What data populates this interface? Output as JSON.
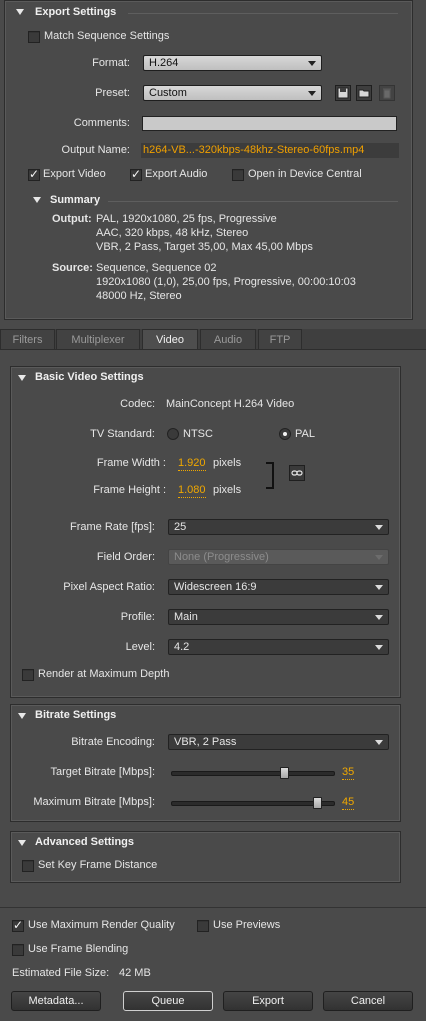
{
  "export_settings": {
    "title": "Export Settings",
    "match_sequence": {
      "label": "Match Sequence Settings",
      "checked": false
    },
    "format": {
      "label": "Format:",
      "value": "H.264"
    },
    "preset": {
      "label": "Preset:",
      "value": "Custom"
    },
    "comments": {
      "label": "Comments:",
      "value": ""
    },
    "output_name": {
      "label": "Output Name:",
      "value": "h264-VB...-320kbps-48khz-Stereo-60fps.mp4"
    },
    "export_video": {
      "label": "Export Video",
      "checked": true
    },
    "export_audio": {
      "label": "Export Audio",
      "checked": true
    },
    "open_device_central": {
      "label": "Open in Device Central",
      "checked": false
    }
  },
  "summary": {
    "title": "Summary",
    "output_label": "Output:",
    "output_lines": [
      "PAL, 1920x1080, 25 fps, Progressive",
      "AAC, 320 kbps, 48 kHz, Stereo",
      "VBR, 2 Pass, Target 35,00, Max 45,00 Mbps"
    ],
    "source_label": "Source:",
    "source_lines": [
      "Sequence, Sequence 02",
      "1920x1080 (1,0), 25,00 fps, Progressive, 00:00:10:03",
      "48000 Hz, Stereo"
    ]
  },
  "tabs": [
    {
      "label": "Filters",
      "active": false
    },
    {
      "label": "Multiplexer",
      "active": false
    },
    {
      "label": "Video",
      "active": true
    },
    {
      "label": "Audio",
      "active": false
    },
    {
      "label": "FTP",
      "active": false
    }
  ],
  "basic_video": {
    "title": "Basic Video Settings",
    "codec_label": "Codec:",
    "codec_value": "MainConcept H.264 Video",
    "tv_label": "TV Standard:",
    "ntsc": "NTSC",
    "pal": "PAL",
    "tv_selected": "PAL",
    "frame_width_label": "Frame Width :",
    "frame_width": "1.920",
    "frame_height_label": "Frame Height :",
    "frame_height": "1.080",
    "pixels": "pixels",
    "frame_rate_label": "Frame Rate [fps]:",
    "frame_rate": "25",
    "field_order_label": "Field Order:",
    "field_order": "None (Progressive)",
    "par_label": "Pixel Aspect Ratio:",
    "par": "Widescreen 16:9",
    "profile_label": "Profile:",
    "profile": "Main",
    "level_label": "Level:",
    "level": "4.2",
    "render_max_depth": {
      "label": "Render at Maximum Depth",
      "checked": false
    }
  },
  "bitrate": {
    "title": "Bitrate Settings",
    "encoding_label": "Bitrate Encoding:",
    "encoding": "VBR, 2 Pass",
    "target_label": "Target Bitrate [Mbps]:",
    "target": "35",
    "target_fraction": 0.7,
    "max_label": "Maximum Bitrate [Mbps]:",
    "max": "45",
    "max_fraction": 0.9
  },
  "advanced": {
    "title": "Advanced Settings",
    "key_frame": {
      "label": "Set Key Frame Distance",
      "checked": false
    }
  },
  "footer": {
    "max_render_quality": {
      "label": "Use Maximum Render Quality",
      "checked": true
    },
    "use_previews": {
      "label": "Use Previews",
      "checked": false
    },
    "frame_blending": {
      "label": "Use Frame Blending",
      "checked": false
    },
    "file_size_label": "Estimated File Size:",
    "file_size": "42 MB",
    "metadata_btn": "Metadata...",
    "queue_btn": "Queue",
    "export_btn": "Export",
    "cancel_btn": "Cancel"
  },
  "colors": {
    "accent_orange": "#f0a800",
    "panel": "#4a4a4a"
  }
}
